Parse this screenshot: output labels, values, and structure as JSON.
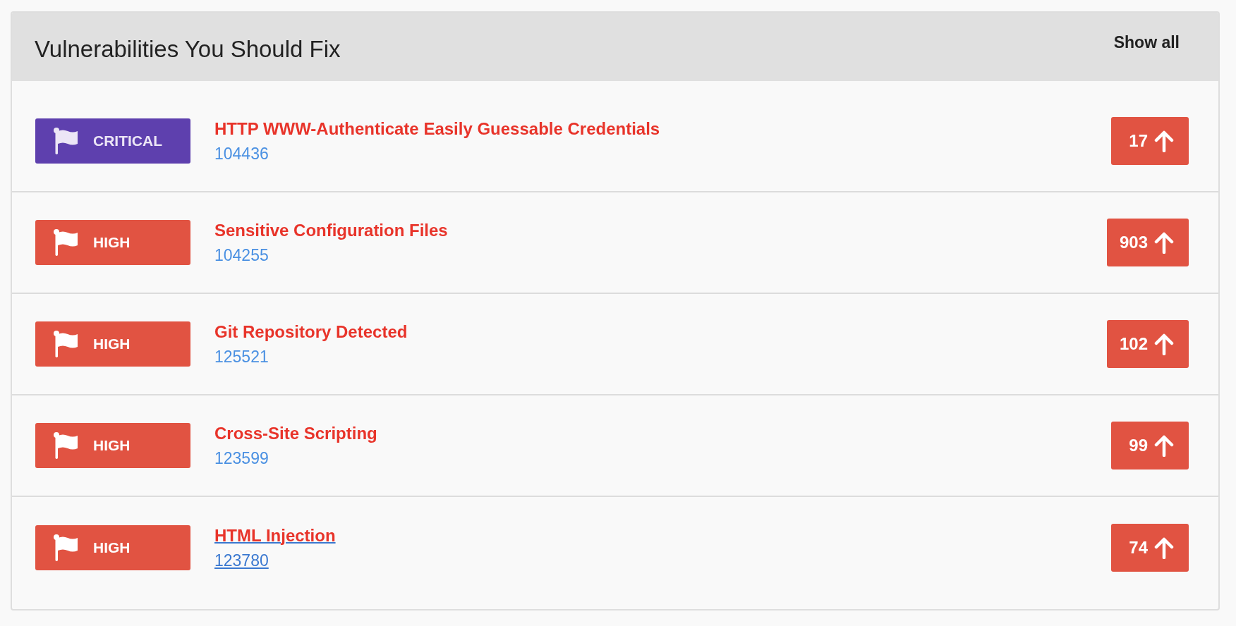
{
  "panel": {
    "title": "Vulnerabilities You Should Fix",
    "show_all": "Show all"
  },
  "vulnerabilities": [
    {
      "severity": "CRITICAL",
      "kind": "critical",
      "name": "HTTP WWW-Authenticate Easily Guessable Credentials",
      "id": "104436",
      "count": "17",
      "hovered": false
    },
    {
      "severity": "HIGH",
      "kind": "high",
      "name": "Sensitive Configuration Files",
      "id": "104255",
      "count": "903",
      "hovered": false
    },
    {
      "severity": "HIGH",
      "kind": "high",
      "name": "Git Repository Detected",
      "id": "125521",
      "count": "102",
      "hovered": false
    },
    {
      "severity": "HIGH",
      "kind": "high",
      "name": "Cross-Site Scripting",
      "id": "123599",
      "count": "99",
      "hovered": false
    },
    {
      "severity": "HIGH",
      "kind": "high",
      "name": "HTML Injection",
      "id": "123780",
      "count": "74",
      "hovered": true
    }
  ]
}
